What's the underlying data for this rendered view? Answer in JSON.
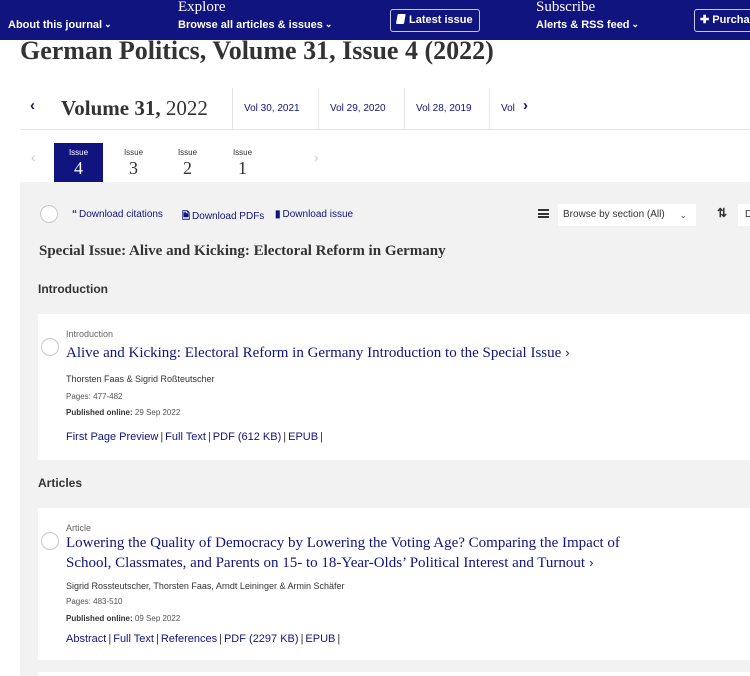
{
  "topnav": {
    "about_label": "About this journal",
    "explore": {
      "title": "Explore",
      "subtitle": "Browse all articles & issues"
    },
    "latest_issue_label": "Latest issue",
    "subscribe": {
      "title": "Subscribe",
      "subtitle": "Alerts & RSS feed"
    },
    "purchase_label": "Purcha"
  },
  "page_title": "German Politics, Volume 31, Issue 4 (2022)",
  "volume_nav": {
    "current_prefix": "Volume 31,",
    "current_year": "2022",
    "links": [
      "Vol 30, 2021",
      "Vol 29, 2020",
      "Vol 28, 2019",
      "Vol"
    ]
  },
  "issue_tabs": [
    {
      "label": "Issue",
      "number": "4",
      "active": true
    },
    {
      "label": "Issue",
      "number": "3",
      "active": false
    },
    {
      "label": "Issue",
      "number": "2",
      "active": false
    },
    {
      "label": "Issue",
      "number": "1",
      "active": false
    }
  ],
  "toolbar": {
    "download_citations": "Download citations",
    "download_pdfs": "Download PDFs",
    "download_issue": "Download issue",
    "browse_select": "Browse by section (All)",
    "sort_select": "D"
  },
  "special_issue_title": "Special Issue: Alive and Kicking: Electoral Reform in Germany",
  "sections": [
    {
      "heading": "Introduction",
      "articles": [
        {
          "type": "Introduction",
          "title": "Alive and Kicking: Electoral Reform in Germany Introduction to the Special Issue",
          "authors": "Thorsten Faas & Sigrid Roßteutscher",
          "pages": "Pages: 477-482",
          "published_label": "Published online:",
          "published_date": "29 Sep 2022",
          "links": [
            "First Page Preview",
            "Full Text",
            "PDF (612 KB)",
            "EPUB"
          ]
        }
      ]
    },
    {
      "heading": "Articles",
      "articles": [
        {
          "type": "Article",
          "title_line1": "Lowering the Quality of Democracy by Lowering the Voting Age? Comparing the Impact of",
          "title_line2": "School, Classmates, and Parents on 15- to 18-Year-Olds’ Political Interest and Turnout",
          "authors": "Sigrid Rossteutscher, Thorsten Faas, Arndt Leininger & Armin Schäfer",
          "pages": "Pages: 483-510",
          "published_label": "Published online:",
          "published_date": "09 Sep 2022",
          "links": [
            "Abstract",
            "Full Text",
            "References",
            "PDF (2297 KB)",
            "EPUB"
          ]
        }
      ]
    }
  ]
}
